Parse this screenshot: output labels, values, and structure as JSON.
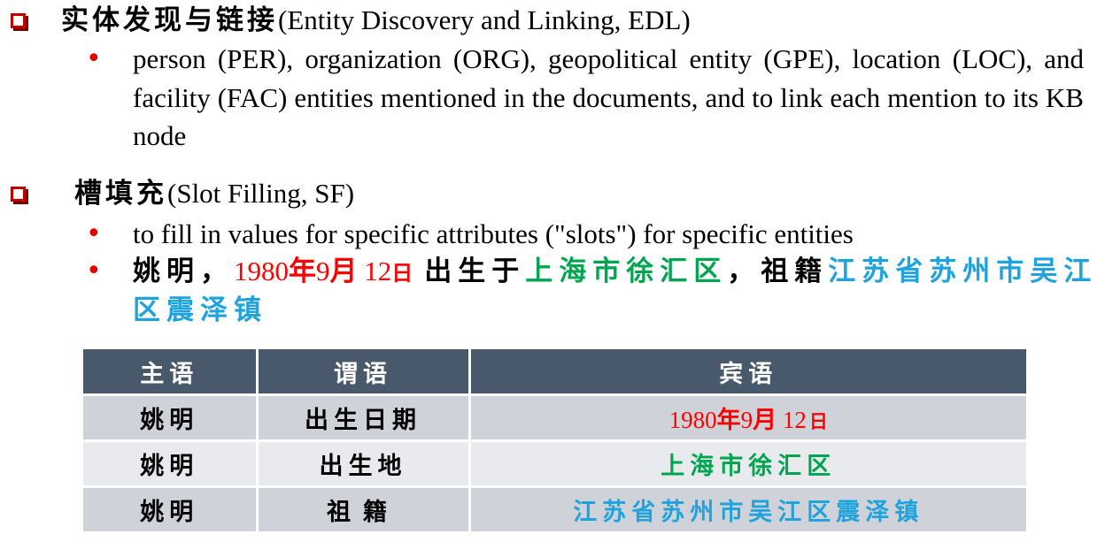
{
  "sections": [
    {
      "title_zh": "实体发现与链接",
      "title_en": " (Entity Discovery and Linking, EDL)",
      "bullets": [
        {
          "text": "person (PER), organization (ORG), geopolitical entity (GPE), location (LOC), and facility (FAC) entities mentioned in the documents, and to link each mention to its KB node"
        }
      ]
    },
    {
      "title_zh": "槽填充",
      "title_en": " (Slot Filling, SF)",
      "bullets": [
        {
          "text": "to fill in values for specific attributes (\"slots\") for specific entities"
        },
        {
          "example": {
            "subject": "姚明",
            "sep1": "，",
            "date_num1": "1980",
            "date_year": "年",
            "date_num2": "9",
            "date_month": "月",
            "date_num3": " 12",
            "date_day": "日",
            "verb": "出生于",
            "place": "上海市徐汇区",
            "sep2": "，",
            "relation": "祖籍",
            "origin_line1": "江苏省苏州市吴江",
            "origin_line2": "区震泽镇"
          }
        }
      ]
    }
  ],
  "table": {
    "headers": [
      "主语",
      "谓语",
      "宾语"
    ],
    "rows": [
      {
        "subject": "姚明",
        "predicate": "出生日期",
        "object": {
          "num1": "1980",
          "year": "年",
          "num2": "9",
          "month": "月",
          "num3": " 12",
          "day": "日"
        }
      },
      {
        "subject": "姚明",
        "predicate": "出生地",
        "object_text": "上海市徐汇区"
      },
      {
        "subject": "姚明",
        "predicate": "祖籍",
        "object_text": "江苏省苏州市吴江区震泽镇"
      }
    ]
  },
  "colors": {
    "checkbox": "#c00000",
    "bullet": "#e00000",
    "date": "#ff0000",
    "birthplace": "#00a550",
    "origin": "#1fa3dc",
    "table_header": "#47596a",
    "row_odd": "#cfd3d9",
    "row_even": "#e8eaed"
  },
  "icons": {
    "section_marker": "checkbox-square-icon",
    "list_marker": "bullet-dot-icon"
  }
}
